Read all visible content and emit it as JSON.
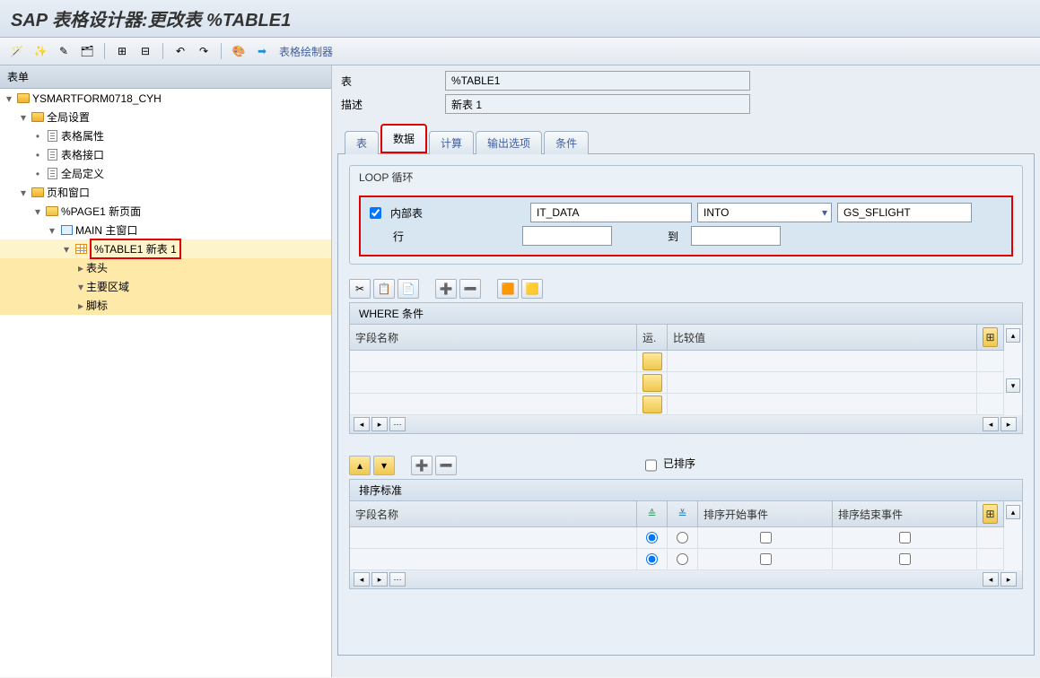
{
  "title": "SAP 表格设计器:更改表 %TABLE1",
  "toolbar_painter": "表格绘制器",
  "tree_header": "表单",
  "tree": {
    "root": "YSMARTFORM0718_CYH",
    "global": "全局设置",
    "form_attr": "表格属性",
    "form_intf": "表格接口",
    "global_def": "全局定义",
    "pages": "页和窗口",
    "page1": "%PAGE1 新页面",
    "main_win": "MAIN 主窗口",
    "table1": "%TABLE1 新表 1",
    "thead": "表头",
    "tmain": "主要区域",
    "tfoot": "脚标"
  },
  "fields": {
    "table_lbl": "表",
    "table_val": "%TABLE1",
    "desc_lbl": "描述",
    "desc_val": "新表 1"
  },
  "tabs": {
    "t1": "表",
    "t2": "数据",
    "t3": "计算",
    "t4": "输出选项",
    "t5": "条件"
  },
  "loop": {
    "title": "LOOP 循环",
    "itab_lbl": "内部表",
    "itab_val": "IT_DATA",
    "into_val": "INTO",
    "wa_val": "GS_SFLIGHT",
    "row_lbl": "行",
    "to_lbl": "到"
  },
  "where": {
    "title": "WHERE 条件",
    "col_field": "字段名称",
    "col_op": "运.",
    "col_val": "比较值"
  },
  "sort": {
    "sorted_lbl": "已排序",
    "title": "排序标准",
    "col_field": "字段名称",
    "col_start": "排序开始事件",
    "col_end": "排序结束事件"
  }
}
